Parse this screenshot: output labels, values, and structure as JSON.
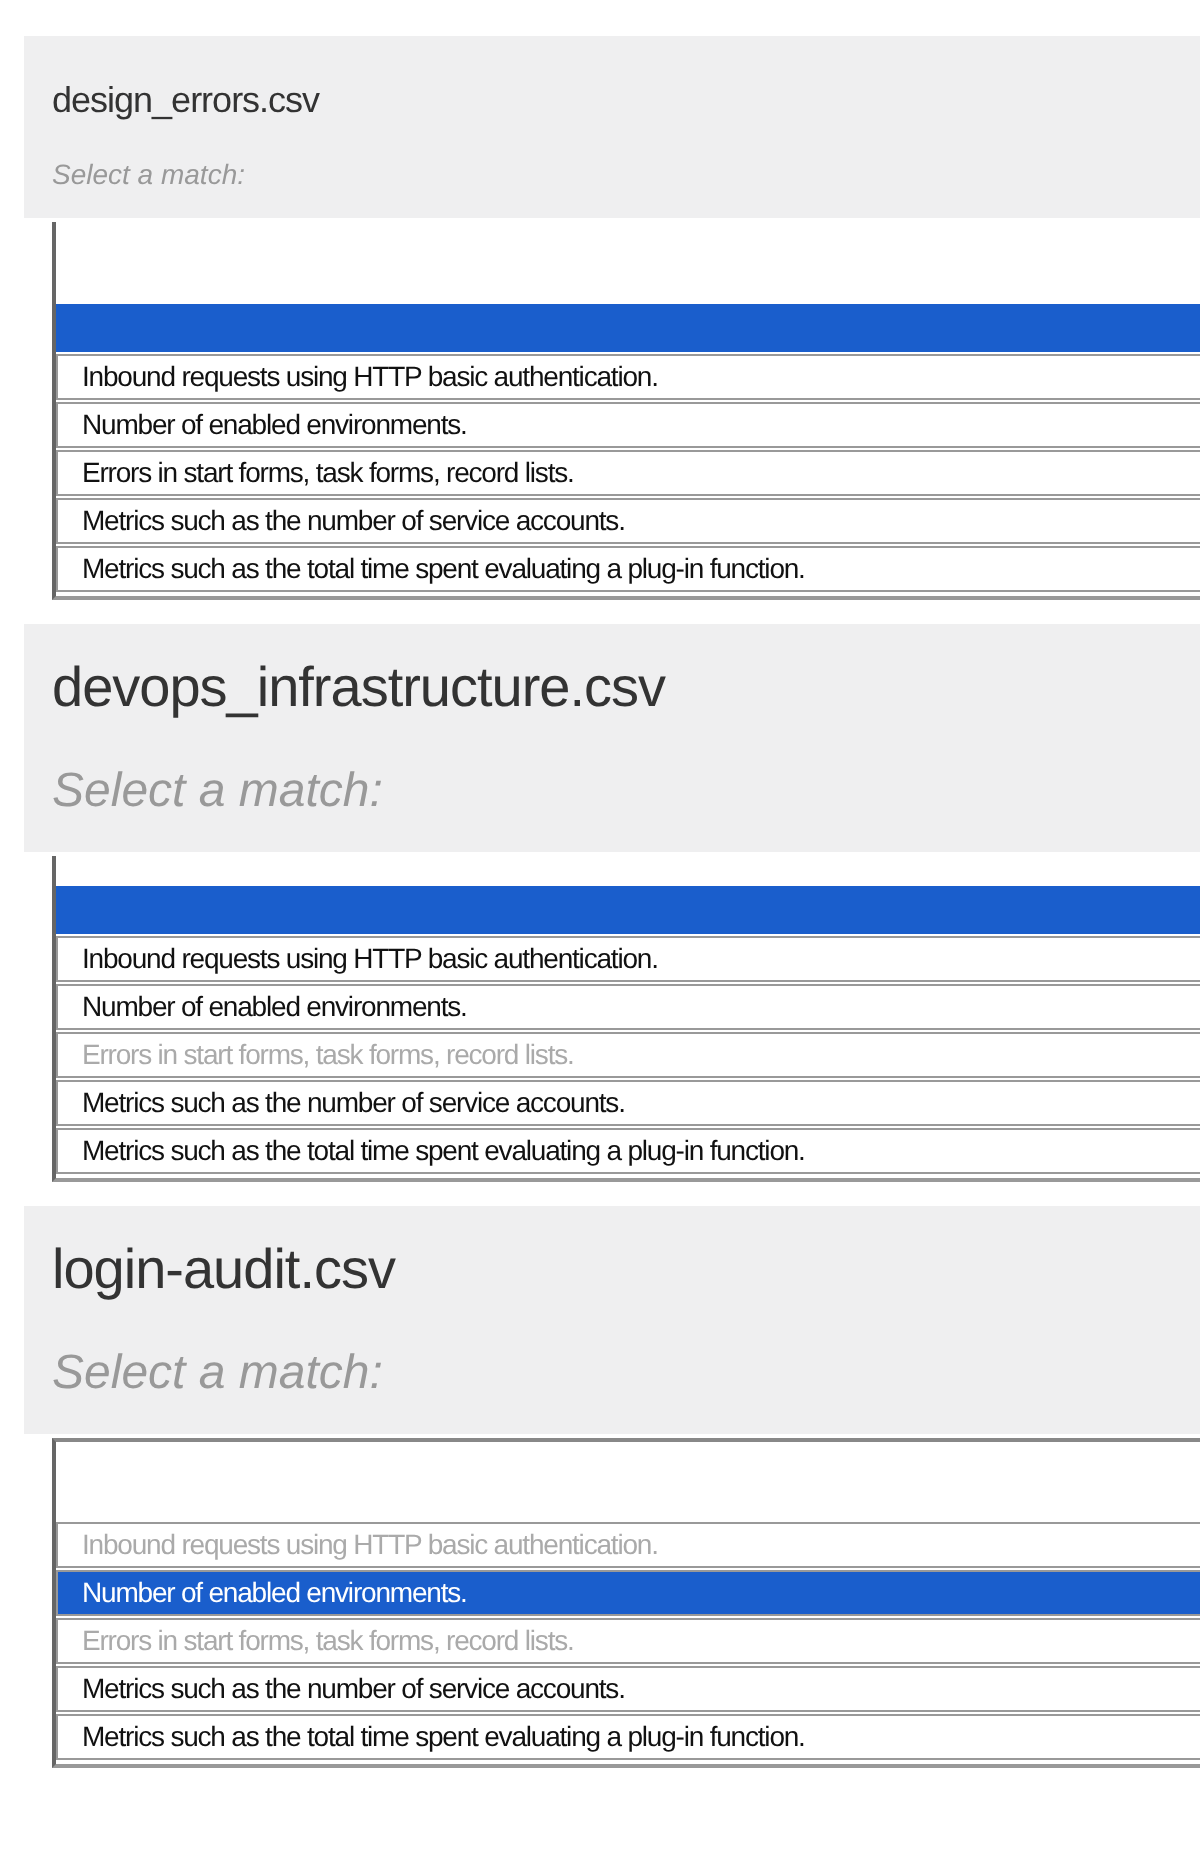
{
  "sections": [
    {
      "title": "design_errors.csv",
      "placeholder": "Select a match:",
      "blank_option_selected": true,
      "options": [
        {
          "label": "Inbound requests using HTTP basic authentication.",
          "selected": false,
          "disabled": false
        },
        {
          "label": "Number of enabled environments.",
          "selected": false,
          "disabled": false
        },
        {
          "label": "Errors in start forms, task forms, record lists.",
          "selected": false,
          "disabled": false
        },
        {
          "label": "Metrics such as the number of service accounts.",
          "selected": false,
          "disabled": false
        },
        {
          "label": "Metrics such as the total time spent evaluating a plug-in function.",
          "selected": false,
          "disabled": false
        }
      ]
    },
    {
      "title": "devops_infrastructure.csv",
      "placeholder": "Select a match:",
      "blank_option_selected": true,
      "options": [
        {
          "label": "Inbound requests using HTTP basic authentication.",
          "selected": false,
          "disabled": false
        },
        {
          "label": "Number of enabled environments.",
          "selected": false,
          "disabled": false
        },
        {
          "label": "Errors in start forms, task forms, record lists.",
          "selected": false,
          "disabled": true
        },
        {
          "label": "Metrics such as the number of service accounts.",
          "selected": false,
          "disabled": false
        },
        {
          "label": "Metrics such as the total time spent evaluating a plug-in function.",
          "selected": false,
          "disabled": false
        }
      ]
    },
    {
      "title": "login-audit.csv",
      "placeholder": "Select a match:",
      "blank_option_selected": false,
      "options": [
        {
          "label": "Inbound requests using HTTP basic authentication.",
          "selected": false,
          "disabled": true
        },
        {
          "label": "Number of enabled environments.",
          "selected": true,
          "disabled": false
        },
        {
          "label": "Errors in start forms, task forms, record lists.",
          "selected": false,
          "disabled": true
        },
        {
          "label": "Metrics such as the number of service accounts.",
          "selected": false,
          "disabled": false
        },
        {
          "label": "Metrics such as the total time spent evaluating a plug-in function.",
          "selected": false,
          "disabled": false
        }
      ]
    }
  ]
}
